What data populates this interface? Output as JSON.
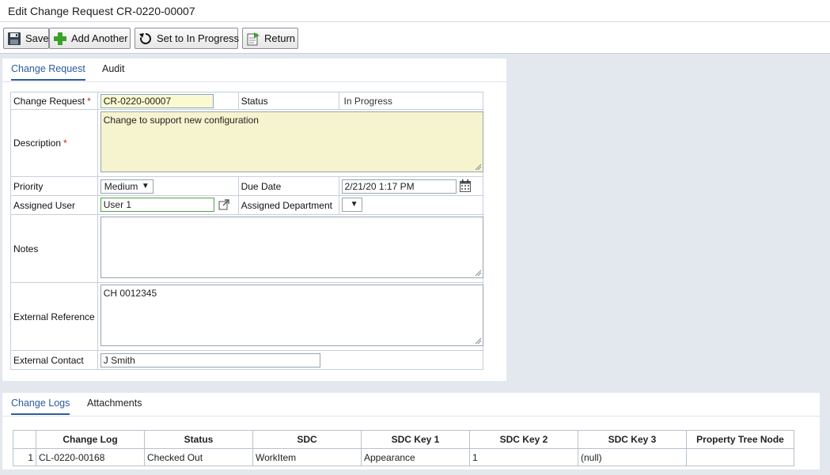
{
  "header": {
    "title": "Edit Change Request CR-0220-00007"
  },
  "toolbar": {
    "save": "Save",
    "add_another": "Add Another",
    "set_in_progress": "Set to In Progress",
    "return": "Return"
  },
  "form_tabs": [
    {
      "label": "Change Request",
      "active": true
    },
    {
      "label": "Audit",
      "active": false
    }
  ],
  "form": {
    "change_request_label": "Change Request",
    "change_request_value": "CR-0220-00007",
    "status_label": "Status",
    "status_value": "In Progress",
    "description_label": "Description",
    "description_value": "Change to support new configuration",
    "priority_label": "Priority",
    "priority_value": "Medium",
    "due_date_label": "Due Date",
    "due_date_value": "2/21/20 1:17 PM",
    "assigned_user_label": "Assigned User",
    "assigned_user_value": "User 1",
    "assigned_department_label": "Assigned Department",
    "assigned_department_value": "",
    "notes_label": "Notes",
    "notes_value": "",
    "external_reference_label": "External Reference",
    "external_reference_value": "CH 0012345",
    "external_contact_label": "External Contact",
    "external_contact_value": "J Smith",
    "required_marker": "*"
  },
  "bottom_tabs": [
    {
      "label": "Change Logs",
      "active": true
    },
    {
      "label": "Attachments",
      "active": false
    }
  ],
  "change_logs": {
    "columns": [
      "",
      "Change Log",
      "Status",
      "SDC",
      "SDC Key 1",
      "SDC Key 2",
      "SDC Key 3",
      "Property Tree Node"
    ],
    "rows": [
      [
        "1",
        "CL-0220-00168",
        "Checked Out",
        "WorkItem",
        "Appearance",
        "1",
        "(null)",
        ""
      ]
    ]
  },
  "icons": {
    "save": "floppy-disk-icon",
    "add": "green-plus-icon",
    "refresh": "refresh-icon",
    "return": "return-document-icon",
    "calendar": "calendar-icon",
    "open_link": "open-external-icon",
    "dropdown": "dropdown-arrow-icon"
  },
  "colors": {
    "accent": "#2b5c9c",
    "required": "#d02020",
    "required_field_bg": "#fbf9cf",
    "background": "#e3e7ee"
  }
}
